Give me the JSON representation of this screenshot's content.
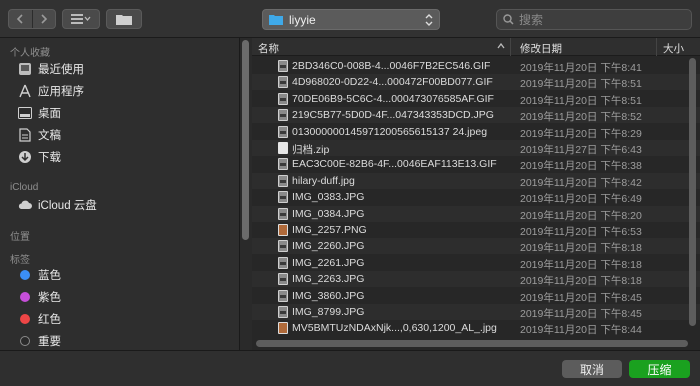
{
  "toolbar": {
    "path_label": "liyyie",
    "search_placeholder": "搜索"
  },
  "sidebar": {
    "favorites_title": "个人收藏",
    "favorites": [
      {
        "label": "最近使用"
      },
      {
        "label": "应用程序"
      },
      {
        "label": "桌面"
      },
      {
        "label": "文稿"
      },
      {
        "label": "下载"
      }
    ],
    "icloud_title": "iCloud",
    "icloud_items": [
      {
        "label": "iCloud 云盘"
      }
    ],
    "locations_title": "位置",
    "tags_title": "标签",
    "tags": [
      {
        "label": "蓝色",
        "color": "#3b8ef5"
      },
      {
        "label": "紫色",
        "color": "#c64fd9"
      },
      {
        "label": "红色",
        "color": "#ee4646"
      },
      {
        "label": "重要",
        "color": "#2a2a2a"
      }
    ]
  },
  "filelist": {
    "col_name": "名称",
    "col_date": "修改日期",
    "col_size": "大小",
    "rows": [
      {
        "name": "2BD346C0-008B-4...0046F7B2EC546.GIF",
        "date": "2019年11月20日 下午8:41",
        "icon": "img"
      },
      {
        "name": "4D968020-0D22-4...000472F00BD077.GIF",
        "date": "2019年11月20日 下午8:51",
        "icon": "img"
      },
      {
        "name": "70DE06B9-5C6C-4...000473076585AF.GIF",
        "date": "2019年11月20日 下午8:51",
        "icon": "img"
      },
      {
        "name": "219C5B77-5D0D-4F...047343353DCD.JPG",
        "date": "2019年11月20日 下午8:52",
        "icon": "img"
      },
      {
        "name": "013000000145971200565615137 24.jpeg",
        "date": "2019年11月20日 下午8:29",
        "icon": "img"
      },
      {
        "name": "归档.zip",
        "date": "2019年11月27日 下午6:43",
        "icon": "zip"
      },
      {
        "name": "EAC3C00E-82B6-4F...0046EAF113E13.GIF",
        "date": "2019年11月20日 下午8:38",
        "icon": "img"
      },
      {
        "name": "hilary-duff.jpg",
        "date": "2019年11月20日 下午8:42",
        "icon": "img"
      },
      {
        "name": "IMG_0383.JPG",
        "date": "2019年11月20日 下午6:49",
        "icon": "img"
      },
      {
        "name": "IMG_0384.JPG",
        "date": "2019年11月20日 下午8:20",
        "icon": "img"
      },
      {
        "name": "IMG_2257.PNG",
        "date": "2019年11月20日 下午6:53",
        "icon": "tall"
      },
      {
        "name": "IMG_2260.JPG",
        "date": "2019年11月20日 下午8:18",
        "icon": "img"
      },
      {
        "name": "IMG_2261.JPG",
        "date": "2019年11月20日 下午8:18",
        "icon": "img"
      },
      {
        "name": "IMG_2263.JPG",
        "date": "2019年11月20日 下午8:18",
        "icon": "img"
      },
      {
        "name": "IMG_3860.JPG",
        "date": "2019年11月20日 下午8:45",
        "icon": "img"
      },
      {
        "name": "IMG_8799.JPG",
        "date": "2019年11月20日 下午8:45",
        "icon": "img"
      },
      {
        "name": "MV5BMTUzNDAxNjk...,0,630,1200_AL_.jpg",
        "date": "2019年11月20日 下午8:44",
        "icon": "tall"
      }
    ]
  },
  "footer": {
    "cancel_label": "取消",
    "primary_label": "压缩"
  }
}
